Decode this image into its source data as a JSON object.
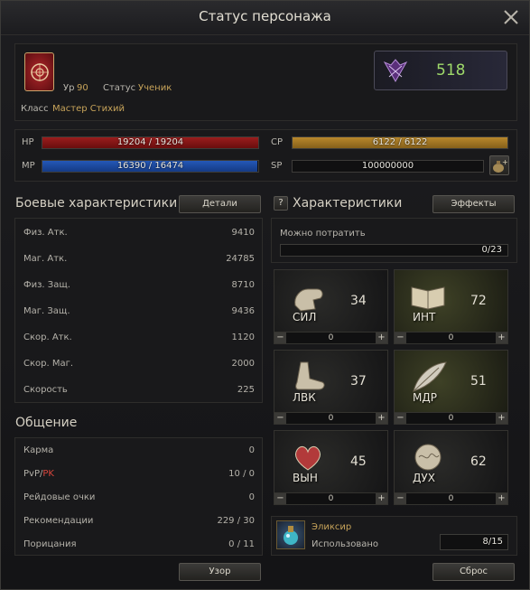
{
  "window": {
    "title": "Статус персонажа"
  },
  "character": {
    "level_label": "Ур",
    "level": "90",
    "status_label": "Статус",
    "status": "Ученик",
    "class_label": "Класс",
    "class": "Мастер Стихий",
    "rank_value": "518"
  },
  "bars": {
    "hp": {
      "label": "HP",
      "text": "19204 / 19204",
      "fill": 1.0
    },
    "mp": {
      "label": "MP",
      "text": "16390 / 16474",
      "fill": 0.995
    },
    "cp": {
      "label": "CP",
      "text": "6122 / 6122",
      "fill": 1.0
    },
    "sp": {
      "label": "SP",
      "text": "100000000",
      "fill": 0
    }
  },
  "combat": {
    "title": "Боевые характеристики",
    "details_button": "Детали",
    "rows": [
      {
        "label": "Физ. Атк.",
        "value": "9410"
      },
      {
        "label": "Маг. Атк.",
        "value": "24785"
      },
      {
        "label": "Физ. Защ.",
        "value": "8710"
      },
      {
        "label": "Маг. Защ.",
        "value": "9436"
      },
      {
        "label": "Скор. Атк.",
        "value": "1120"
      },
      {
        "label": "Скор. Маг.",
        "value": "2000"
      },
      {
        "label": "Скорость",
        "value": "225"
      }
    ]
  },
  "social": {
    "title": "Общение",
    "rows": [
      {
        "label": "Карма",
        "value": "0"
      },
      {
        "label_a": "PvP/",
        "label_b": "PK",
        "value": "10 / 0"
      },
      {
        "label": "Рейдовые очки",
        "value": "0"
      },
      {
        "label": "Рекомендации",
        "value": "229 / 30"
      },
      {
        "label": "Порицания",
        "value": "0 / 11"
      }
    ],
    "inspect_button": "Узор"
  },
  "stats": {
    "help": "?",
    "title": "Характеристики",
    "effects_button": "Эффекты",
    "spendable_label": "Можно потратить",
    "spendable_value": "0/23",
    "cells": [
      {
        "name": "СИЛ",
        "value": "34",
        "points": "0",
        "icon": "fist-icon"
      },
      {
        "name": "ИНТ",
        "value": "72",
        "points": "0",
        "icon": "book-icon"
      },
      {
        "name": "ЛВК",
        "value": "37",
        "points": "0",
        "icon": "foot-icon"
      },
      {
        "name": "МДР",
        "value": "51",
        "points": "0",
        "icon": "feather-icon"
      },
      {
        "name": "ВЫН",
        "value": "45",
        "points": "0",
        "icon": "heart-icon"
      },
      {
        "name": "ДУХ",
        "value": "62",
        "points": "0",
        "icon": "brain-icon"
      }
    ],
    "minus": "−",
    "plus": "+",
    "elixir_label": "Эликсир",
    "elixir_used_label": "Использовано",
    "elixir_value": "8/15",
    "reset_button": "Сброс"
  },
  "colors": {
    "accent_gold": "#c8a45a",
    "rank_green": "#9ed96a",
    "pk_red": "#d6453c"
  }
}
